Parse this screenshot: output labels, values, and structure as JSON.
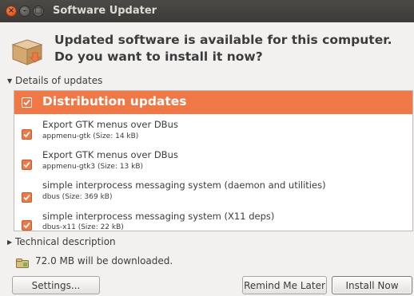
{
  "window": {
    "title": "Software Updater",
    "controls": {
      "close": "×",
      "minimize": "–",
      "maximize": "□"
    }
  },
  "header": {
    "icon": "package-icon",
    "message": "Updated software is available for this computer. Do you want to install it now?"
  },
  "details_expander": {
    "label": "Details of updates",
    "expanded": true
  },
  "updates": {
    "group": {
      "label": "Distribution updates",
      "checked": true
    },
    "items": [
      {
        "name": "Export GTK menus over DBus",
        "detail": "appmenu-gtk (Size: 14 kB)",
        "checked": true
      },
      {
        "name": "Export GTK menus over DBus",
        "detail": "appmenu-gtk3 (Size: 13 kB)",
        "checked": true
      },
      {
        "name": "simple interprocess messaging system (daemon and utilities)",
        "detail": "dbus (Size: 369 kB)",
        "checked": true
      },
      {
        "name": "simple interprocess messaging system (X11 deps)",
        "detail": "dbus-x11 (Size: 22 kB)",
        "checked": true
      }
    ]
  },
  "technical_expander": {
    "label": "Technical description",
    "expanded": false
  },
  "download": {
    "icon": "download-size-icon",
    "text": "72.0 MB will be downloaded."
  },
  "buttons": {
    "settings": "Settings...",
    "remind": "Remind Me Later",
    "install": "Install Now"
  },
  "colors": {
    "accent": "#f07746",
    "titlebar": "#3c3b37",
    "window_bg": "#f2f1f0"
  }
}
